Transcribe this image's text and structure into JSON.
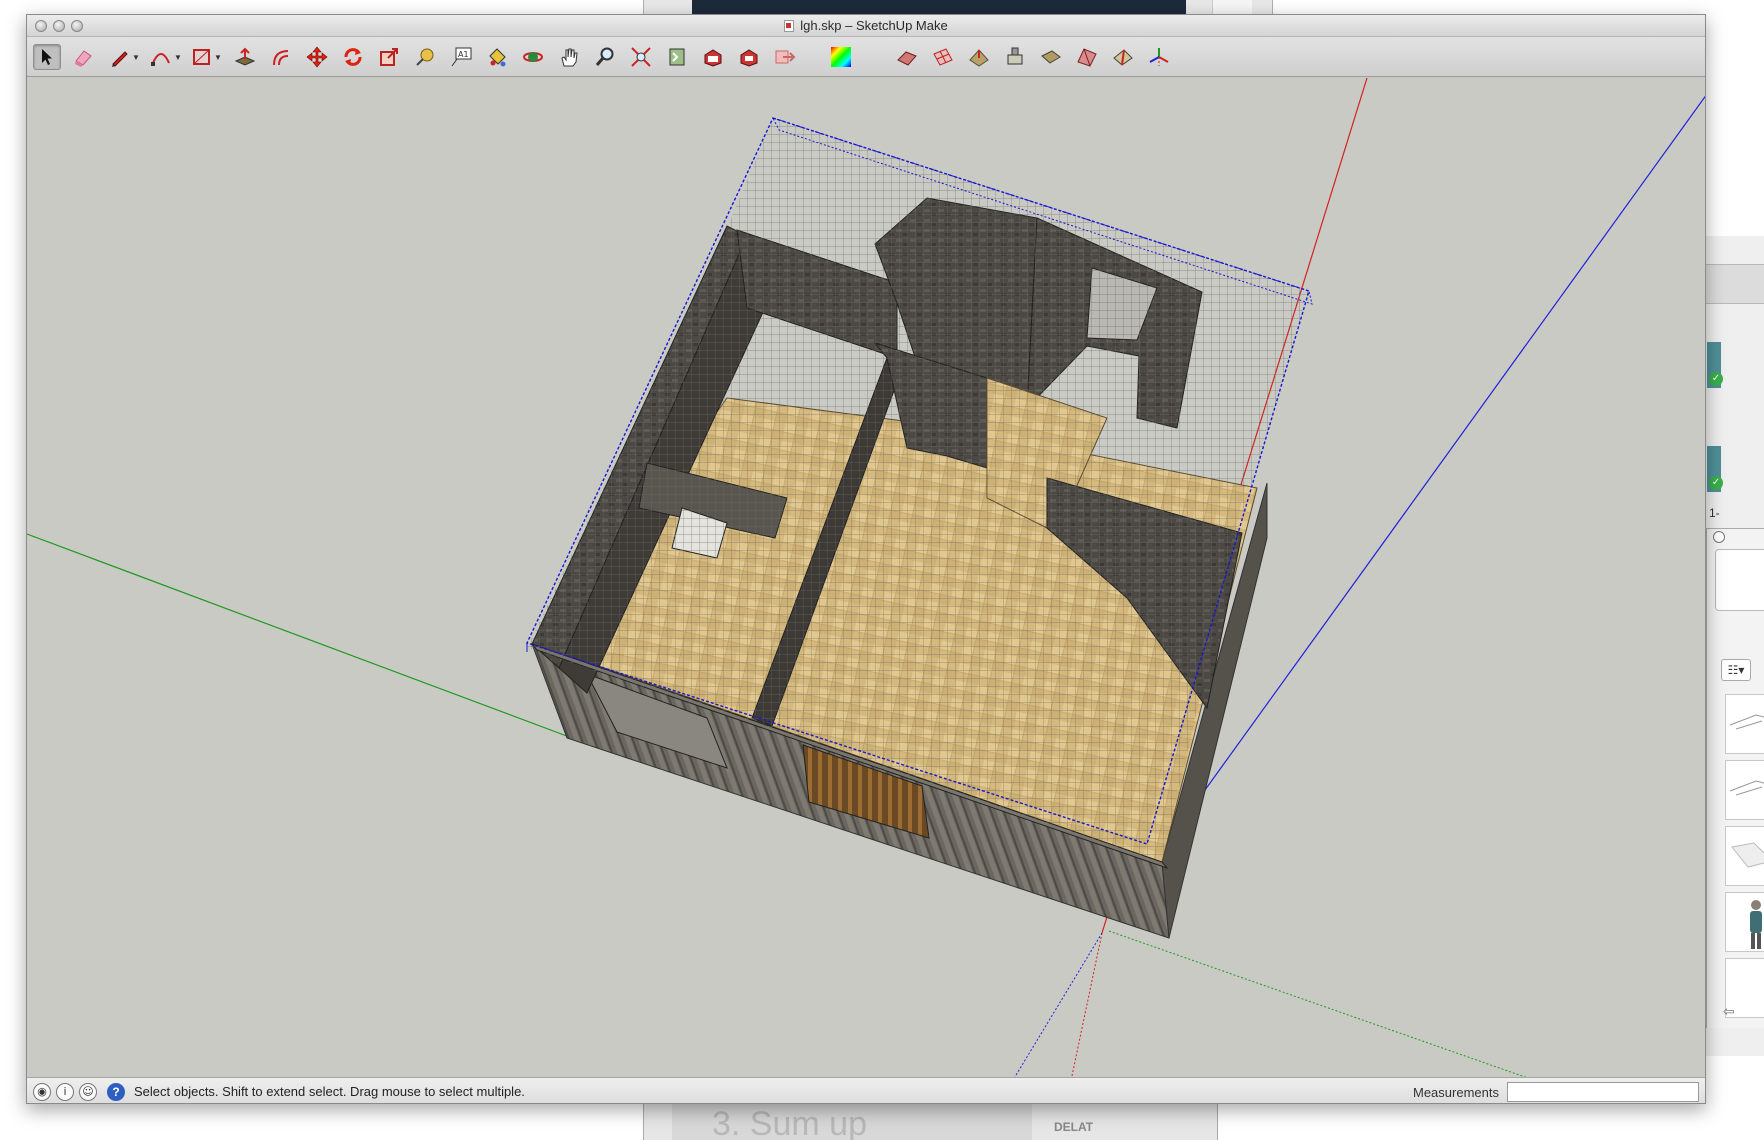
{
  "window": {
    "title": "lgh.skp – SketchUp Make"
  },
  "toolbar": {
    "tools": [
      {
        "name": "select-tool",
        "icon": "arrow-cursor-icon"
      },
      {
        "name": "eraser-tool",
        "icon": "eraser-icon"
      },
      {
        "name": "line-tool",
        "icon": "pencil-icon"
      },
      {
        "name": "arc-tool",
        "icon": "arc-icon"
      },
      {
        "name": "rectangle-tool",
        "icon": "rectangle-icon"
      },
      {
        "name": "push-pull-tool",
        "icon": "push-pull-icon"
      },
      {
        "name": "offset-tool",
        "icon": "offset-icon"
      },
      {
        "name": "move-tool",
        "icon": "move-icon"
      },
      {
        "name": "rotate-tool",
        "icon": "rotate-icon"
      },
      {
        "name": "scale-tool",
        "icon": "scale-icon"
      },
      {
        "name": "tape-measure-tool",
        "icon": "tape-measure-icon"
      },
      {
        "name": "text-tool",
        "icon": "text-icon"
      },
      {
        "name": "paint-bucket-tool",
        "icon": "paint-bucket-icon"
      },
      {
        "name": "orbit-tool",
        "icon": "orbit-icon"
      },
      {
        "name": "pan-tool",
        "icon": "hand-icon"
      },
      {
        "name": "zoom-tool",
        "icon": "magnifier-icon"
      },
      {
        "name": "zoom-extents-tool",
        "icon": "zoom-extents-icon"
      },
      {
        "name": "previous-view-tool",
        "icon": "previous-view-icon"
      },
      {
        "name": "warehouse-tool",
        "icon": "warehouse-icon"
      },
      {
        "name": "extension-warehouse-tool",
        "icon": "extension-warehouse-icon"
      },
      {
        "name": "share-model-tool",
        "icon": "share-model-icon"
      },
      {
        "name": "styles-tool",
        "icon": "color-palette-icon"
      },
      {
        "name": "sandbox-from-contours-tool",
        "icon": "sandbox-contours-icon"
      },
      {
        "name": "sandbox-from-scratch-tool",
        "icon": "sandbox-grid-icon"
      },
      {
        "name": "smoove-tool",
        "icon": "smoove-icon"
      },
      {
        "name": "stamp-tool",
        "icon": "stamp-icon"
      },
      {
        "name": "drape-tool",
        "icon": "drape-icon"
      },
      {
        "name": "add-detail-tool",
        "icon": "add-detail-icon"
      },
      {
        "name": "flip-edge-tool",
        "icon": "flip-edge-icon"
      },
      {
        "name": "axes-tool",
        "icon": "axes-icon"
      }
    ]
  },
  "status": {
    "hint": "Select objects. Shift to extend select. Drag mouse to select multiple.",
    "measurements_label": "Measurements",
    "measurements_value": ""
  },
  "background": {
    "bottom_window_heading": "3. Sum up",
    "bottom_window_label": "DELAT",
    "right_panel_label": "1-"
  },
  "colors": {
    "axis_red": "#d42020",
    "axis_green": "#1c9a1c",
    "axis_blue": "#2020d8",
    "wall": "#4a4742",
    "floor": "#d4b77a",
    "selection": "#1818d0"
  }
}
